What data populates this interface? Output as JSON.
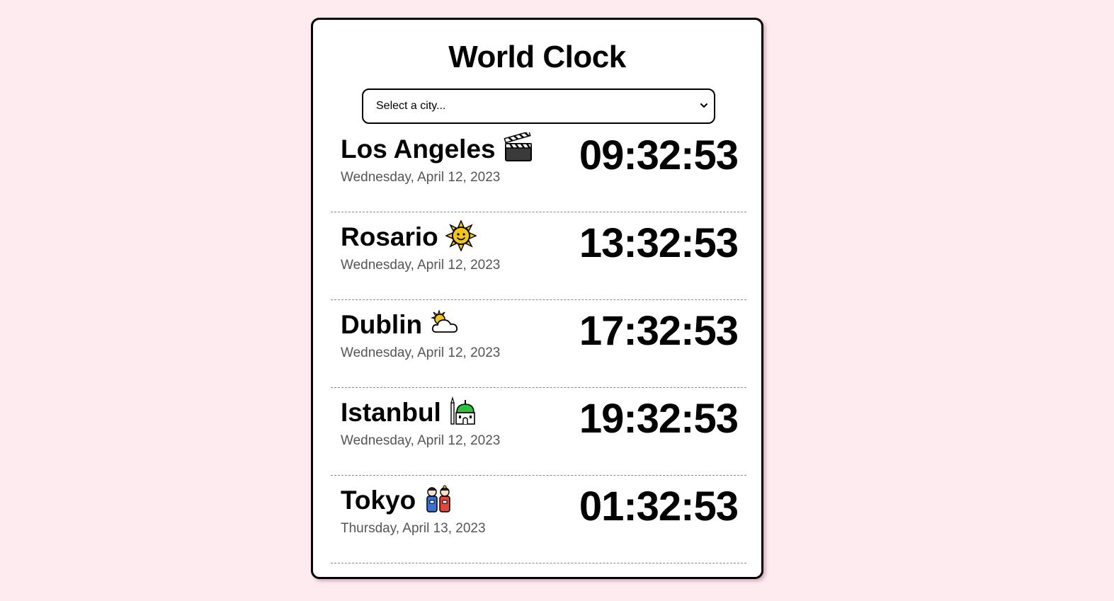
{
  "app": {
    "title": "World Clock"
  },
  "city_select": {
    "value": "Select a city..."
  },
  "cities": [
    {
      "name": "Los Angeles",
      "emoji": "clapper-board-icon",
      "date": "Wednesday, April 12, 2023",
      "time": "09:32:53"
    },
    {
      "name": "Rosario",
      "emoji": "sun-with-face-icon",
      "date": "Wednesday, April 12, 2023",
      "time": "13:32:53"
    },
    {
      "name": "Dublin",
      "emoji": "sun-behind-cloud-icon",
      "date": "Wednesday, April 12, 2023",
      "time": "17:32:53"
    },
    {
      "name": "Istanbul",
      "emoji": "mosque-icon",
      "date": "Wednesday, April 12, 2023",
      "time": "19:32:53"
    },
    {
      "name": "Tokyo",
      "emoji": "japanese-dolls-icon",
      "date": "Thursday, April 13, 2023",
      "time": "01:32:53"
    }
  ],
  "colors": {
    "background": "#fdebf0",
    "card": "#ffffff",
    "border": "#000000",
    "date_text": "#555555"
  }
}
